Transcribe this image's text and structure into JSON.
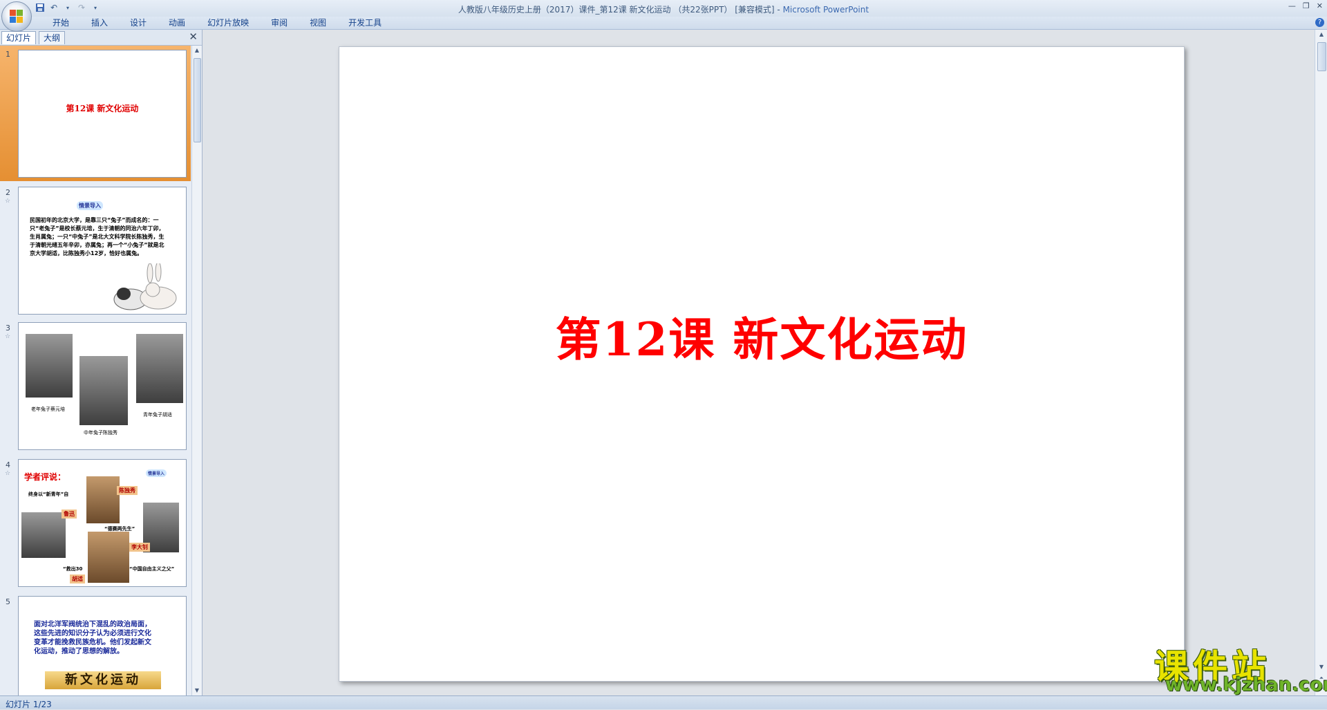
{
  "app": {
    "title_doc": "人教版八年级历史上册（2017）课件_第12课 新文化运动 （共22张PPT） [兼容模式] - ",
    "title_app": "Microsoft PowerPoint"
  },
  "ribbon": {
    "tabs": [
      "开始",
      "插入",
      "设计",
      "动画",
      "幻灯片放映",
      "审阅",
      "视图",
      "开发工具"
    ]
  },
  "left_pane": {
    "tabs": [
      "幻灯片",
      "大纲"
    ],
    "slides": [
      {
        "num": "1",
        "title": "第12课 新文化运动"
      },
      {
        "num": "2",
        "badge": "情景导入",
        "text": "民国初年的北京大学，是靠三只“兔子”而成名的：一只“老兔子”是校长蔡元培，生于清朝的同治六年丁卯，生肖属兔；一只“中兔子”是北大文科学院长陈独秀，生于清朝光绪五年辛卯，亦属兔；再一个“小兔子”就是北京大学胡适，比陈独秀小12岁，恰好也属兔。"
      },
      {
        "num": "3",
        "captions": [
          "老年兔子蔡元培",
          "中年兔子陈独秀",
          "青年兔子胡适"
        ]
      },
      {
        "num": "4",
        "heading": "学者评说：",
        "badge": "情景导入",
        "names": [
          "陈独秀",
          "鲁迅",
          "李大钊",
          "胡适"
        ],
        "lines": [
          "终身以“新青年”自",
          "“德赛两先生”",
          "“中国自由主义之父”",
          "“救出30"
        ]
      },
      {
        "num": "5",
        "text": "面对北洋军阀统治下混乱的政治局面，这些先进的知识分子认为必须进行文化变革才能挽救民族危机。他们发起新文化运动，推动了思想的解放。",
        "banner": "新文化运动"
      }
    ]
  },
  "slide": {
    "title": "第12课  新文化运动"
  },
  "status": {
    "slide_indicator": "幻灯片 1/23"
  },
  "watermark": {
    "cn": "课件站",
    "url": "www.kjzhan.com"
  }
}
